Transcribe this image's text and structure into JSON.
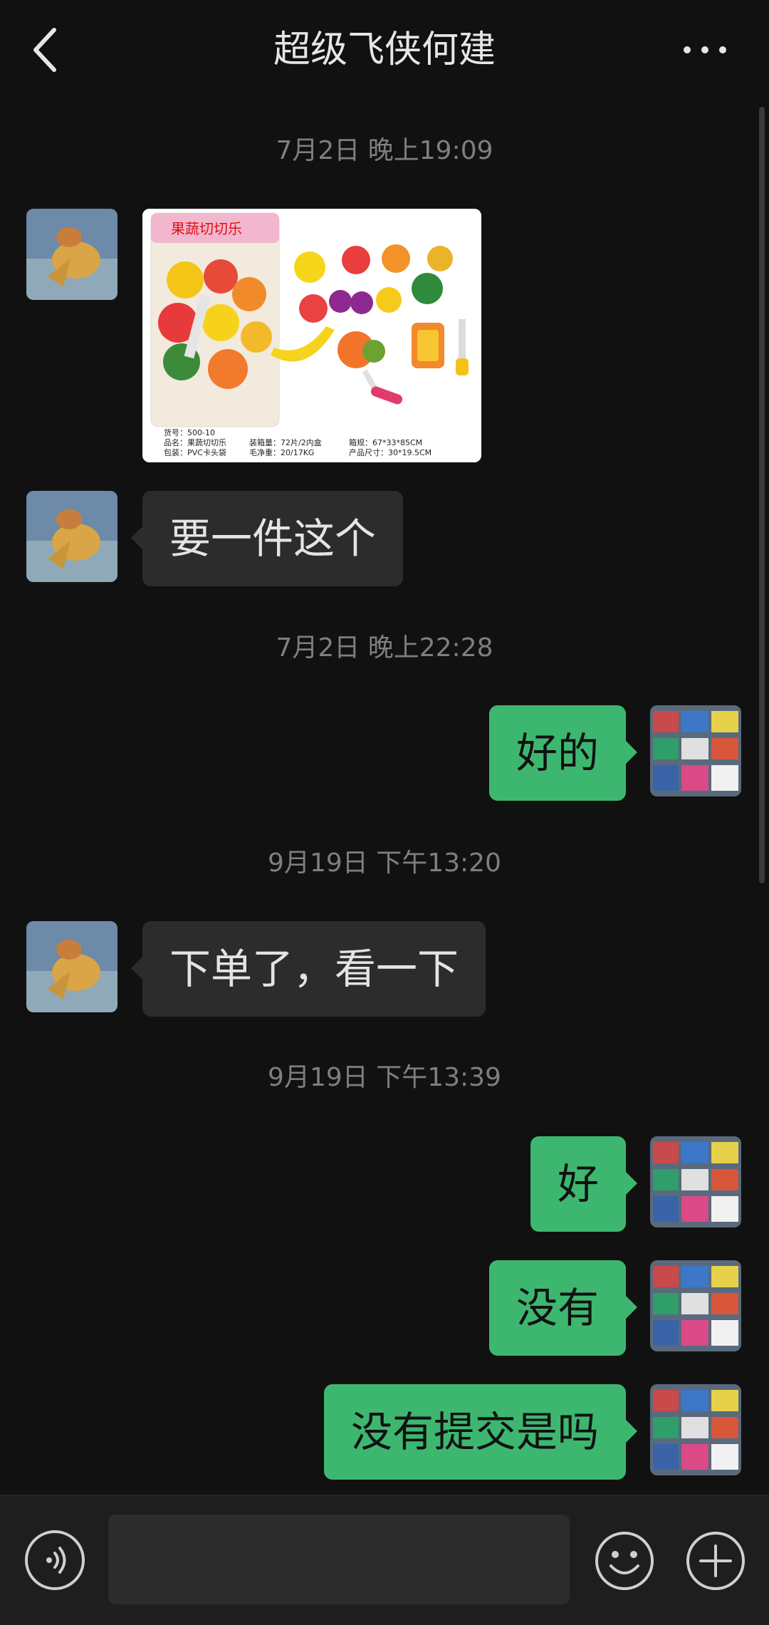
{
  "header": {
    "title": "超级飞侠何建",
    "back_icon": "back-arrow-icon",
    "more_icon": "more-dots-icon"
  },
  "messages": [
    {
      "type": "timestamp",
      "text": "7月2日 晚上19:09"
    },
    {
      "type": "image",
      "from": "other",
      "product": {
        "box_title": "果蔬切切乐",
        "spec_lines": [
          "货号：500-10",
          "品名：果蔬切切乐",
          "包装：PVC卡头袋"
        ],
        "spec_lines2": [
          "装箱量：72片/2内盒",
          "毛净重：20/17KG"
        ],
        "spec_lines3": [
          "箱规：67*33*85CM",
          "产品尺寸：30*19.5CM"
        ]
      }
    },
    {
      "type": "text",
      "from": "other",
      "text": "要一件这个"
    },
    {
      "type": "timestamp",
      "text": "7月2日 晚上22:28"
    },
    {
      "type": "text",
      "from": "self",
      "text": "好的"
    },
    {
      "type": "timestamp",
      "text": "9月19日 下午13:20"
    },
    {
      "type": "text",
      "from": "other",
      "text": "下单了，看一下"
    },
    {
      "type": "timestamp",
      "text": "9月19日 下午13:39"
    },
    {
      "type": "text",
      "from": "self",
      "text": "好"
    },
    {
      "type": "text",
      "from": "self",
      "text": "没有"
    },
    {
      "type": "text",
      "from": "self",
      "text": "没有提交是吗"
    }
  ],
  "composer": {
    "voice_icon": "voice-icon",
    "input_value": "",
    "emoji_icon": "emoji-icon",
    "plus_icon": "plus-icon"
  },
  "colors": {
    "background": "#111111",
    "self_bubble": "#3db770",
    "other_bubble": "#2c2c2c",
    "timestamp": "#7f7f7f"
  }
}
